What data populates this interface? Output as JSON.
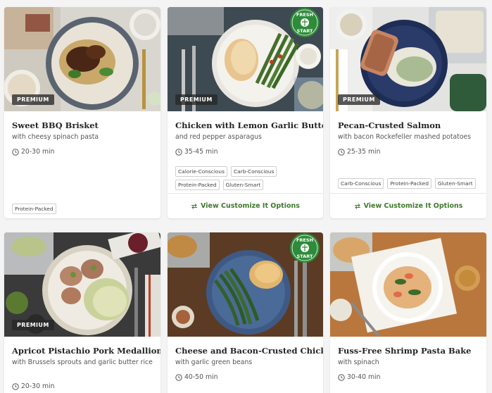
{
  "colors": {
    "accent_green": "#3f7a2c",
    "fresh_start_green": "#2e8b3a",
    "premium_bg": "#3a3a3a",
    "card_bg": "#ffffff",
    "page_bg": "#f4f4f4"
  },
  "badges": {
    "premium": "PREMIUM",
    "fresh_line1": "FRESH",
    "fresh_line2": "START"
  },
  "cards": [
    {
      "title": "Sweet BBQ Brisket",
      "subtitle": "with cheesy spinach pasta",
      "time": "20-30 min",
      "premium": true,
      "fresh_start": false,
      "tags": [
        "Protein-Packed"
      ],
      "customize": ""
    },
    {
      "title": "Chicken with Lemon Garlic Butter",
      "subtitle": "and red pepper asparagus",
      "time": "35-45 min",
      "premium": true,
      "fresh_start": true,
      "tags": [
        "Calorie-Conscious",
        "Carb-Conscious",
        "Protein-Packed",
        "Gluten-Smart"
      ],
      "customize": "View Customize It Options"
    },
    {
      "title": "Pecan-Crusted Salmon",
      "subtitle": "with bacon Rockefeller mashed potatoes",
      "time": "25-35 min",
      "premium": true,
      "fresh_start": false,
      "tags": [
        "Carb-Conscious",
        "Protein-Packed",
        "Gluten-Smart"
      ],
      "customize": "View Customize It Options"
    },
    {
      "title": "Apricot Pistachio Pork Medallions",
      "subtitle": "with Brussels sprouts and garlic butter rice",
      "time": "20-30 min",
      "premium": true,
      "fresh_start": false,
      "tags": [],
      "customize": ""
    },
    {
      "title": "Cheese and Bacon-Crusted Chicken",
      "subtitle": "with garlic green beans",
      "time": "40-50 min",
      "premium": false,
      "fresh_start": true,
      "tags": [],
      "customize": ""
    },
    {
      "title": "Fuss-Free Shrimp Pasta Bake",
      "subtitle": "with spinach",
      "time": "30-40 min",
      "premium": false,
      "fresh_start": false,
      "tags": [],
      "customize": ""
    }
  ]
}
